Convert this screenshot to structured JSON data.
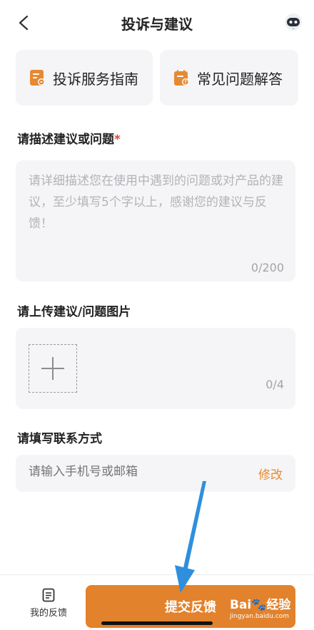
{
  "header": {
    "title": "投诉与建议"
  },
  "quick_links": [
    {
      "label": "投诉服务指南",
      "icon": "guide-doc-icon"
    },
    {
      "label": "常见问题解答",
      "icon": "faq-calendar-icon"
    }
  ],
  "description": {
    "label": "请描述建议或问题",
    "required_mark": "*",
    "placeholder": "请详细描述您在使用中遇到的问题或对产品的建议，至少填写5个字以上，感谢您的建议与反馈！",
    "counter": "0/200"
  },
  "upload": {
    "label": "请上传建议/问题图片",
    "counter": "0/4"
  },
  "contact": {
    "label": "请填写联系方式",
    "placeholder": "请输入手机号或邮箱",
    "edit_label": "修改"
  },
  "bottom": {
    "my_feedback_label": "我的反馈",
    "submit_label": "提交反馈"
  },
  "watermark": {
    "main": "Bai🐾经验",
    "sub": "jingyan.baidu.com"
  },
  "colors": {
    "accent": "#e2822c",
    "field_bg": "#f5f5f7",
    "required": "#e0483a",
    "arrow": "#2f8fdc"
  }
}
